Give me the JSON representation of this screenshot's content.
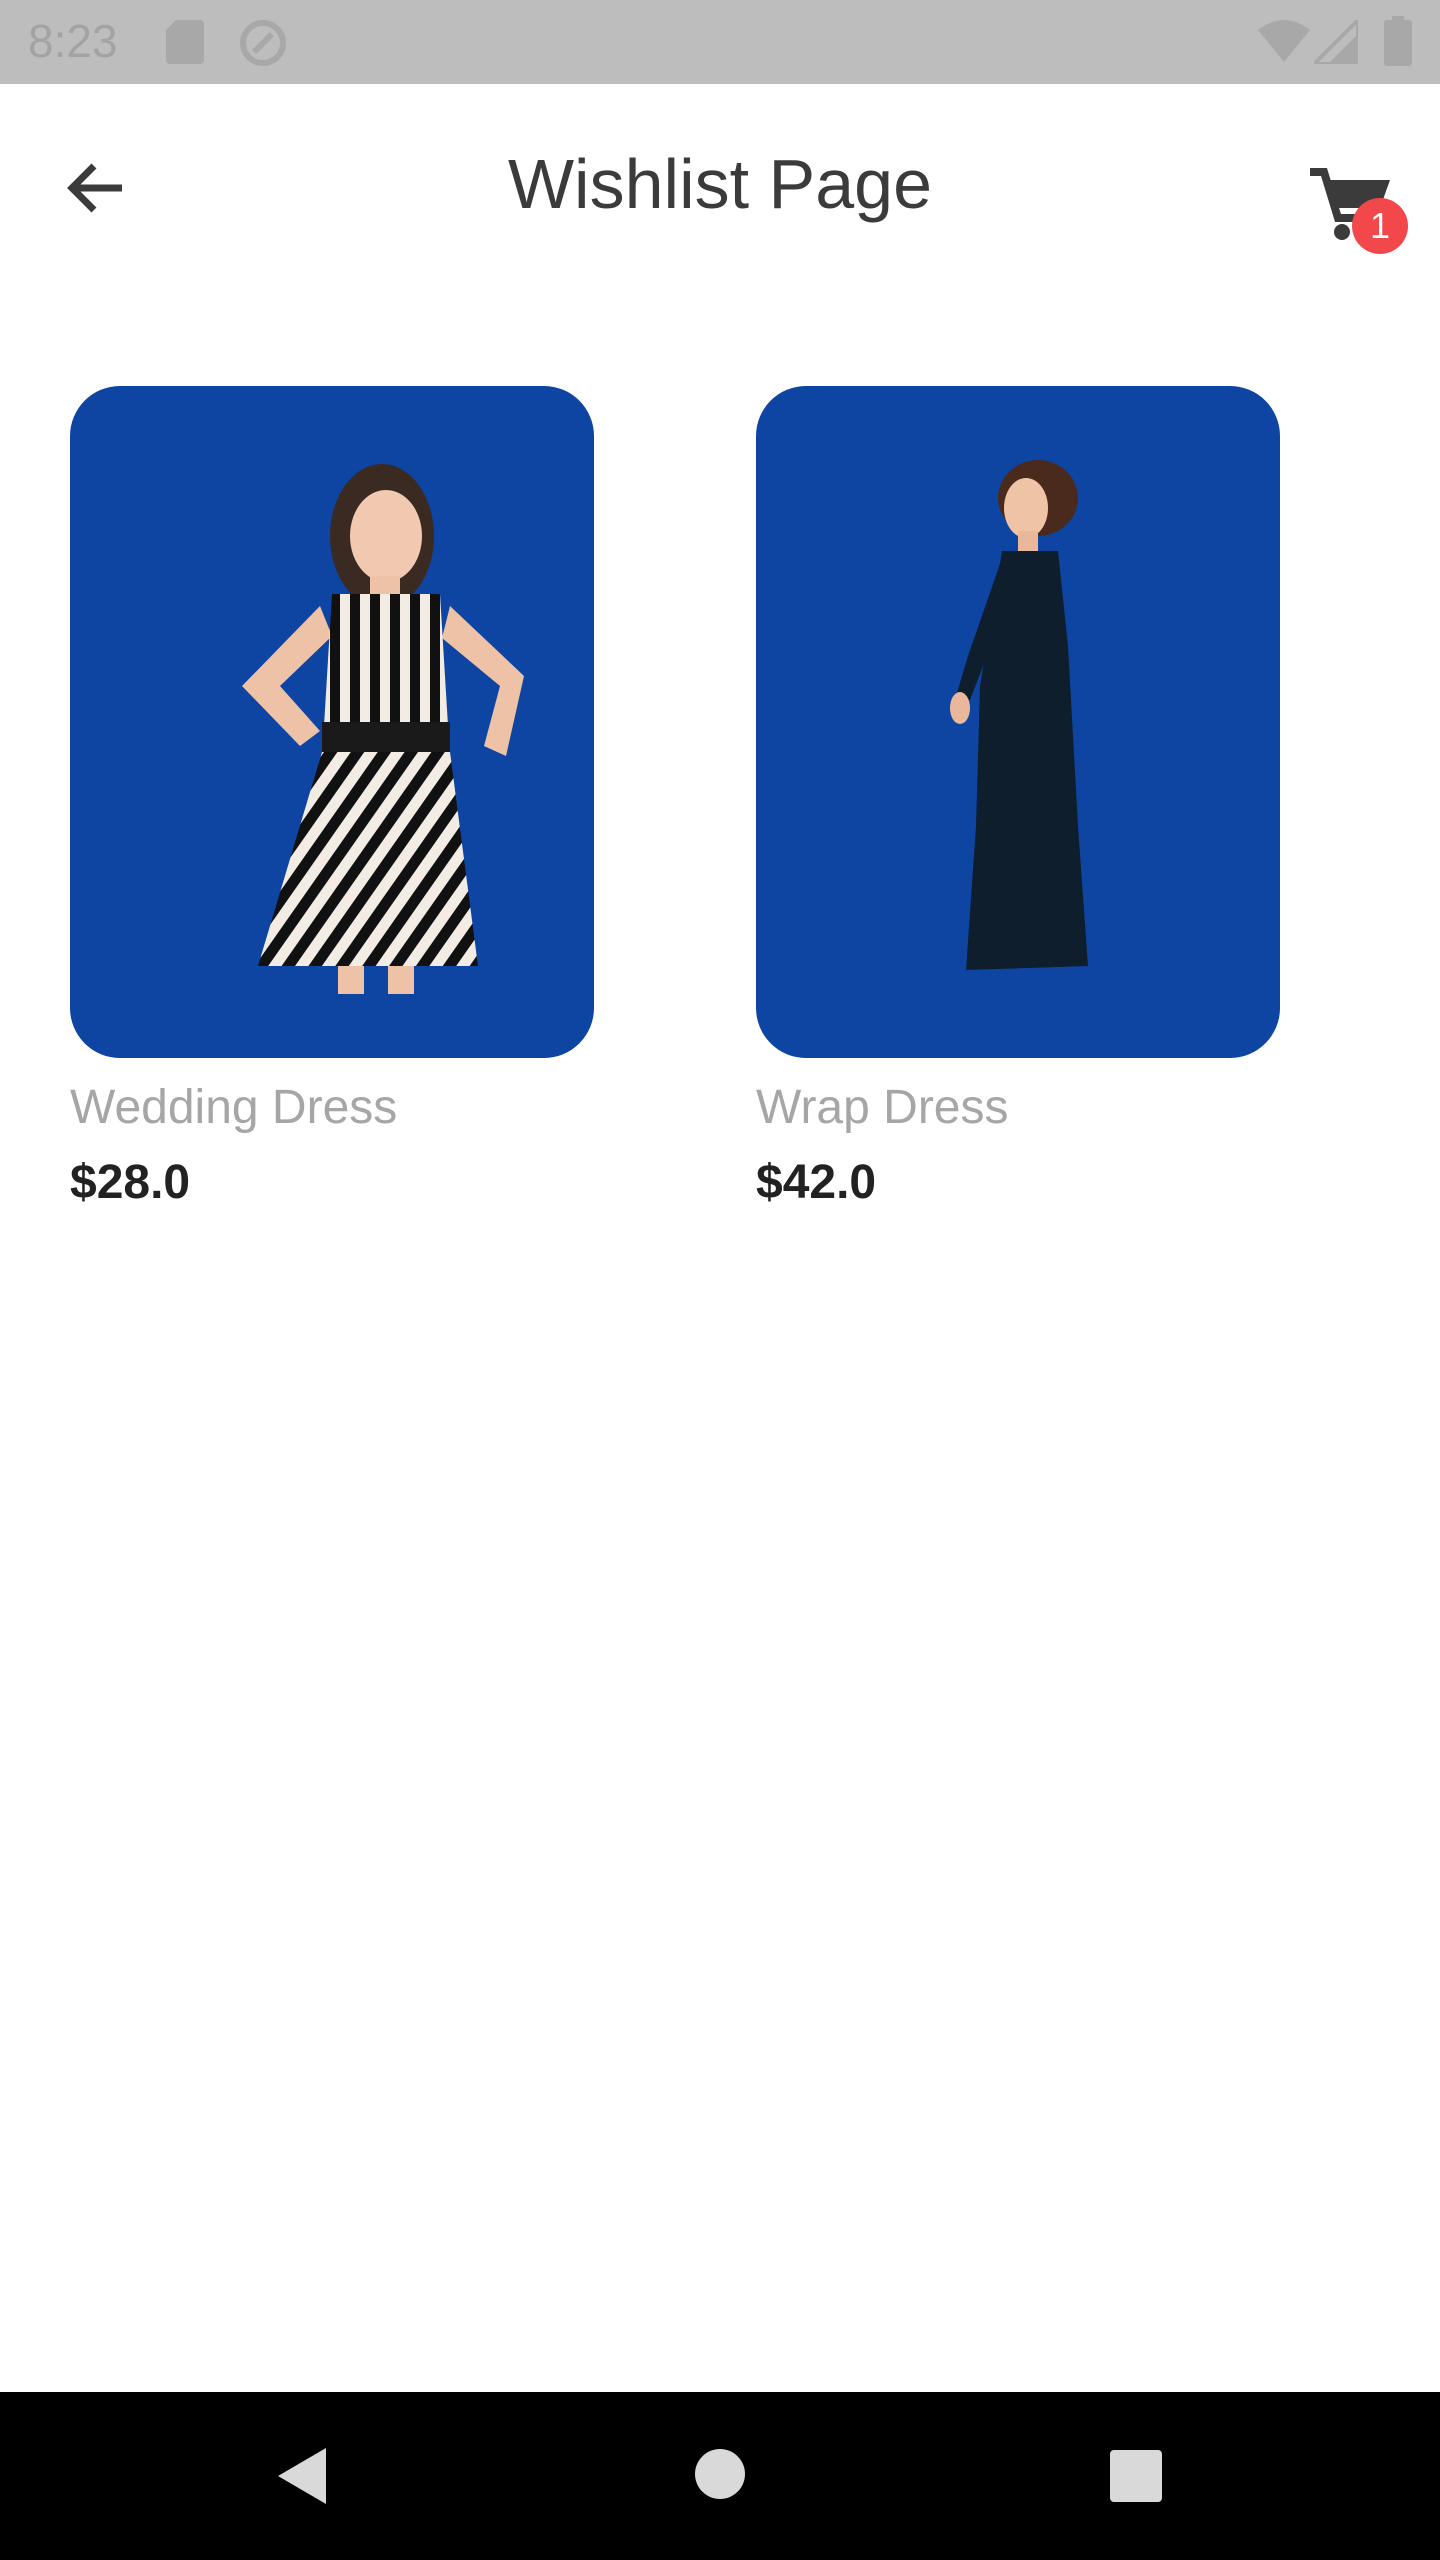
{
  "status_bar": {
    "time": "8:23",
    "icons": [
      "sd-card-icon",
      "sync-disabled-icon",
      "wifi-icon",
      "signal-icon",
      "battery-icon"
    ]
  },
  "app_bar": {
    "title": "Wishlist Page",
    "back_icon": "arrow-back-icon",
    "cart_icon": "shopping-cart-icon",
    "cart_badge": "1"
  },
  "products": [
    {
      "name": "Wedding Dress",
      "price": "$28.0",
      "image_bg": "#0e45a3",
      "image": "striped-dress-model"
    },
    {
      "name": "Wrap Dress",
      "price": "$42.0",
      "image_bg": "#0e45a3",
      "image": "long-dark-dress-model"
    }
  ],
  "nav_bar": {
    "buttons": [
      "back-triangle-icon",
      "home-circle-icon",
      "recents-square-icon"
    ]
  }
}
